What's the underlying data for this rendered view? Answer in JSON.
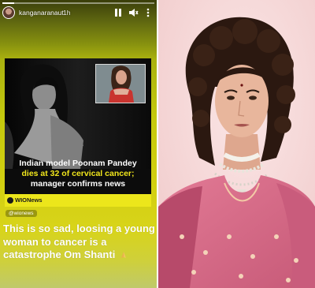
{
  "story": {
    "username": "kanganaranaut",
    "time_ago": "1h",
    "progress_fraction": 0.08,
    "icons": [
      "pause-icon",
      "mute-icon",
      "more-icon"
    ],
    "post": {
      "headline_part1": "Indian model Poonam Pandey",
      "headline_part2": "dies at 32 of cervical cancer;",
      "headline_part3": "manager confirms news",
      "source": "WIONews",
      "source_icon": "wion-logo-icon"
    },
    "mention": "@wionews",
    "caption": "This is so sad, loosing a young woman to cancer is a catastrophe Om Shanti",
    "caption_emoji": "folded-hands-icon"
  },
  "colors": {
    "story_yellow": "#d2cf10",
    "headline_highlight": "#f1e61c",
    "portrait_background": "#f6d7d7",
    "saree_pink": "#d9718d"
  }
}
